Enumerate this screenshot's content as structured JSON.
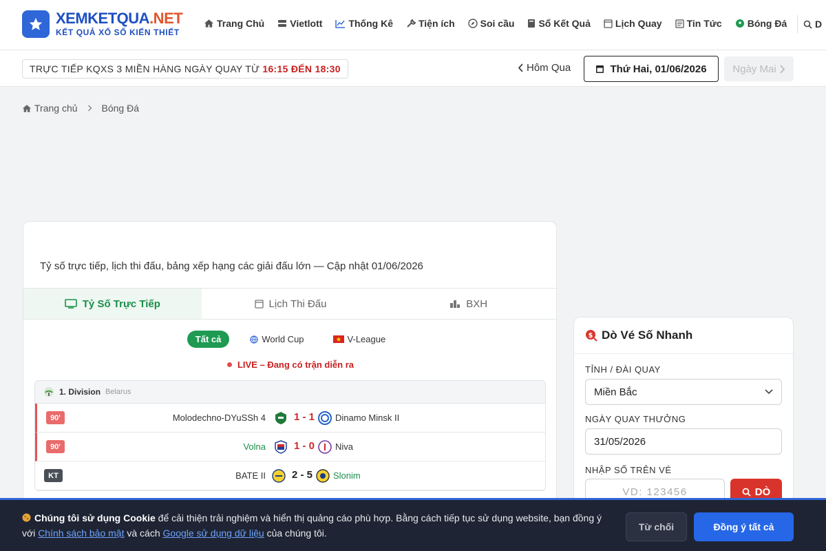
{
  "header": {
    "logo_title_a": "XEMKETQUA",
    "logo_title_b": ".NET",
    "logo_subtitle": "KẾT QUẢ XỔ SỐ KIẾN THIẾT",
    "nav": [
      {
        "label": "Trang Chủ",
        "icon": "home-icon"
      },
      {
        "label": "Vietlott",
        "icon": "server-icon"
      },
      {
        "label": "Thống Kê",
        "icon": "chart-line-icon"
      },
      {
        "label": "Tiện ích",
        "icon": "wrench-icon"
      },
      {
        "label": "Soi cầu",
        "icon": "compass-icon"
      },
      {
        "label": "Sổ Kết Quả",
        "icon": "book-icon"
      },
      {
        "label": "Lịch Quay",
        "icon": "calendar-icon"
      },
      {
        "label": "Tin Tức",
        "icon": "newspaper-icon"
      },
      {
        "label": "Bóng Đá",
        "icon": "soccer-ball-icon"
      }
    ],
    "search_label": "D"
  },
  "subbar": {
    "banner_text": "TRỰC TIẾP KQXS 3 MIỀN HÀNG NGÀY QUAY TỪ",
    "banner_time": "16:15 ĐẾN 18:30",
    "prev_label": "Hôm Qua",
    "current_date": "Thứ Hai, 01/06/2026",
    "next_label": "Ngày Mai"
  },
  "breadcrumb": {
    "home": "Trang chủ",
    "current": "Bóng Đá"
  },
  "main": {
    "intro": "Tỷ số trực tiếp, lịch thi đấu, bảng xếp hạng các giải đấu lớn — Cập nhật 01/06/2026",
    "tabs": [
      {
        "label": "Tỷ Số Trực Tiếp"
      },
      {
        "label": "Lịch Thi Đấu"
      },
      {
        "label": "BXH"
      }
    ],
    "filters": [
      {
        "label": "Tất cả"
      },
      {
        "label": "World Cup"
      },
      {
        "label": "V-League"
      }
    ],
    "live_note": "LIVE – Đang có trận diễn ra",
    "league": {
      "name": "1. Division",
      "country": "Belarus",
      "matches": [
        {
          "status": "90'",
          "home": "Molodechno-DYuSSh 4",
          "score": "1 - 1",
          "away": "Dinamo Minsk II"
        },
        {
          "status": "90'",
          "home": "Volna",
          "score": "1 - 0",
          "away": "Niva"
        },
        {
          "status": "KT",
          "home": "BATE II",
          "score": "2 - 5",
          "away": "Slonim"
        }
      ]
    }
  },
  "sidebar": {
    "title": "Dò Vé Số Nhanh",
    "province_label": "TỈNH / ĐÀI QUAY",
    "province_value": "Miền Bắc",
    "date_label": "NGÀY QUAY THƯỞNG",
    "date_value": "31/05/2026",
    "number_label": "NHẬP SỐ TRÊN VÉ",
    "number_placeholder": "VD: 123456",
    "check_button": "DÒ"
  },
  "cookie": {
    "title": "Chúng tôi sử dụng Cookie",
    "text_1": " để cải thiện trải nghiệm và hiển thị quảng cáo phù hợp. Bằng cách tiếp tục sử dụng website, bạn đồng ý với ",
    "link_1": "Chính sách bảo mật",
    "text_2": " và cách ",
    "link_2": "Google sử dụng dữ liệu",
    "text_3": " của chúng tôi.",
    "reject": "Từ chối",
    "accept": "Đồng ý tất cả"
  },
  "colors": {
    "brand_blue": "#2f66d8",
    "brand_orange": "#e2552d",
    "live_red": "#d02a2a",
    "green": "#1a8f4a"
  }
}
